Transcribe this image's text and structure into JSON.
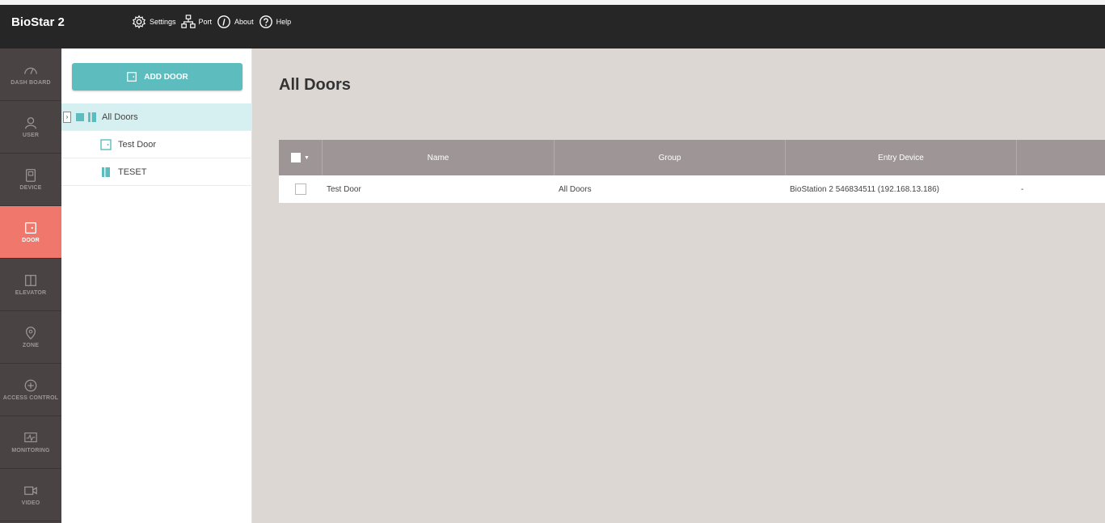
{
  "app": {
    "title": "BioStar 2"
  },
  "topnav": [
    {
      "label": "Settings",
      "icon": "gear-icon"
    },
    {
      "label": "Port",
      "icon": "network-icon"
    },
    {
      "label": "About",
      "icon": "info-icon"
    },
    {
      "label": "Help",
      "icon": "help-icon"
    }
  ],
  "sidebar": {
    "items": [
      {
        "label": "DASH BOARD",
        "icon": "gauge-icon"
      },
      {
        "label": "USER",
        "icon": "user-icon"
      },
      {
        "label": "DEVICE",
        "icon": "device-icon"
      },
      {
        "label": "DOOR",
        "icon": "door-icon"
      },
      {
        "label": "ELEVATOR",
        "icon": "elevator-icon"
      },
      {
        "label": "ZONE",
        "icon": "zone-icon"
      },
      {
        "label": "ACCESS CONTROL",
        "icon": "access-control-icon"
      },
      {
        "label": "MONITORING",
        "icon": "monitoring-icon"
      },
      {
        "label": "VIDEO",
        "icon": "video-icon"
      }
    ],
    "active": "DOOR"
  },
  "tree_panel": {
    "add_button_label": "ADD DOOR",
    "groups": [
      {
        "label": "All Doors",
        "selected": true
      }
    ],
    "doors": [
      {
        "label": "Test Door"
      },
      {
        "label": "TESET"
      }
    ]
  },
  "main": {
    "title": "All Doors",
    "table": {
      "columns": [
        "Name",
        "Group",
        "Entry Device"
      ],
      "rows": [
        {
          "name": "Test Door",
          "group": "All Doors",
          "entry_device": "BioStation 2 546834511 (192.168.13.186)",
          "extra": "-"
        }
      ]
    }
  },
  "colors": {
    "topbar": "#262626",
    "sidebar": "#4a4344",
    "active_nav": "#f0776b",
    "accent": "#5cbcbe",
    "main_bg": "#dcd7d3",
    "table_header": "#9e9696"
  }
}
